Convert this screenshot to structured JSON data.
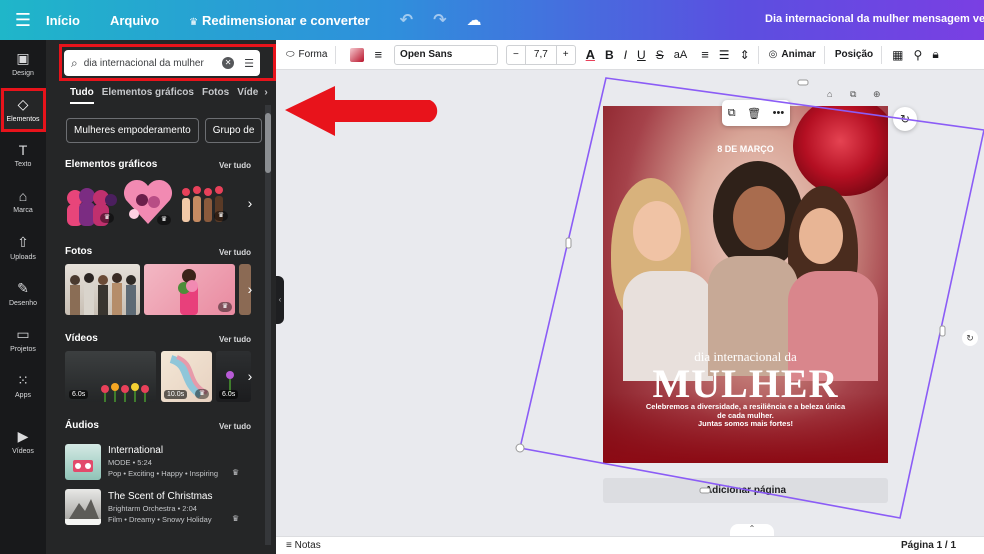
{
  "topbar": {
    "home": "Início",
    "file": "Arquivo",
    "resize": "Redimensionar e converter",
    "doc_title": "Dia internacional da mulher mensagem vermelho b"
  },
  "rail": {
    "items": [
      {
        "label": "Design",
        "icon": "design-icon"
      },
      {
        "label": "Elementos",
        "icon": "elements-icon"
      },
      {
        "label": "Texto",
        "icon": "text-icon"
      },
      {
        "label": "Marca",
        "icon": "brand-icon"
      },
      {
        "label": "Uploads",
        "icon": "upload-icon"
      },
      {
        "label": "Desenho",
        "icon": "draw-icon"
      },
      {
        "label": "Projetos",
        "icon": "folder-icon"
      },
      {
        "label": "Apps",
        "icon": "apps-icon"
      },
      {
        "label": "Vídeos",
        "icon": "video-icon"
      }
    ]
  },
  "panel": {
    "search_value": "dia internacional da mulher",
    "tabs": [
      "Tudo",
      "Elementos gráficos",
      "Fotos",
      "Víde"
    ],
    "chips": [
      "Mulheres empoderamento",
      "Grupo de"
    ],
    "see_all": "Ver tudo",
    "sections": {
      "graphics": "Elementos gráficos",
      "photos": "Fotos",
      "videos": "Vídeos",
      "audios": "Áudios"
    },
    "video_durations": [
      "6.0s",
      "10.0s",
      "6.0s"
    ],
    "audios": [
      {
        "title": "International",
        "artist_time": "MODE • 5:24",
        "tags": "Pop • Exciting • Happy • Inspiring"
      },
      {
        "title": "The Scent of Christmas",
        "artist_time": "Brightarm Orchestra • 2:04",
        "tags": "Film • Dreamy • Snowy Holiday"
      }
    ]
  },
  "toolbar": {
    "shape": "Forma",
    "font": "Open Sans",
    "size": "7,7",
    "animate": "Animar",
    "position": "Posição"
  },
  "design": {
    "date": "8 DE MARÇO",
    "heading_small": "dia internacional da",
    "heading_big": "MULHER",
    "body": "Celebremos a diversidade, a resiliência e a beleza única de cada mulher.",
    "sub": "Juntas somos mais fortes!"
  },
  "canvas": {
    "add_page": "Adicionar página"
  },
  "status": {
    "notes": "Notas",
    "page": "Página 1 / 1"
  },
  "colors": {
    "annotation": "#e8131b",
    "selection": "#8b5cf6",
    "rail_bg": "#18191b",
    "panel_bg": "#252627"
  }
}
